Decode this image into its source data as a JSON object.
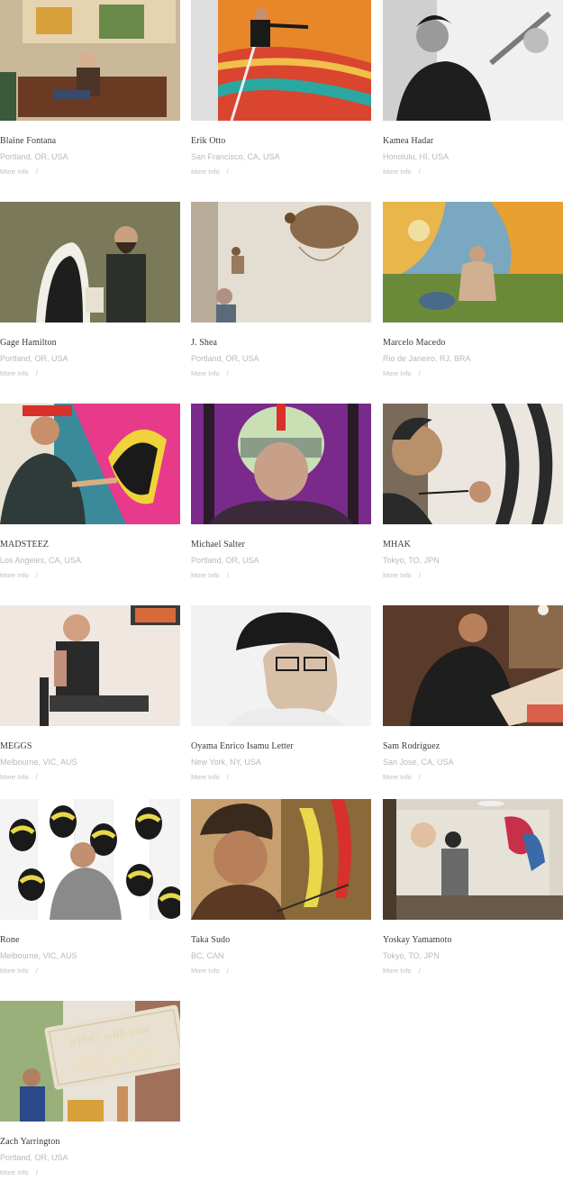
{
  "artists": [
    {
      "name": "Blaine Fontana",
      "location": "Portland, OR, USA",
      "more_info": "More Info",
      "separator": "/",
      "photo": "artist-with-mural-on-sofa",
      "colors": [
        "#c9b89a",
        "#4a3528",
        "#e6d3b0"
      ]
    },
    {
      "name": "Erik Otto",
      "location": "San Francisco, CA, USA",
      "more_info": "More Info",
      "separator": "/",
      "photo": "painter-on-ladder-orange-mural",
      "colors": [
        "#e8862a",
        "#d9452f",
        "#2aa8a0"
      ]
    },
    {
      "name": "Kamea Hadar",
      "location": "Honolulu, HI, USA",
      "more_info": "More Info",
      "separator": "/",
      "photo": "painter-black-and-white",
      "colors": [
        "#e5e5e5",
        "#6a6a6a",
        "#1e1e1e"
      ]
    },
    {
      "name": "Gage Hamilton",
      "location": "Portland, OR, USA",
      "more_info": "More Info",
      "separator": "/",
      "photo": "bearded-man-with-mural",
      "colors": [
        "#8a8a6a",
        "#2c2f2a",
        "#d6d2c4"
      ]
    },
    {
      "name": "J. Shea",
      "location": "Portland, OR, USA",
      "more_info": "More Info",
      "separator": "/",
      "photo": "gallery-sculpture-hanging",
      "colors": [
        "#e4ddd2",
        "#8a6a4a",
        "#b3a48f"
      ]
    },
    {
      "name": "Marcelo Macedo",
      "location": "Rio de Janeiro, RJ, BRA",
      "more_info": "More Info",
      "separator": "/",
      "photo": "painter-sitting-yellow-mural",
      "colors": [
        "#e8b64a",
        "#7aa8c0",
        "#6a8a3a"
      ]
    },
    {
      "name": "MADSTEEZ",
      "location": "Los Angeles, CA, USA",
      "more_info": "More Info",
      "separator": "/",
      "photo": "painter-red-beanie-colorful",
      "colors": [
        "#2f3a3a",
        "#e83a8a",
        "#f0d23a"
      ]
    },
    {
      "name": "Michael Salter",
      "location": "Portland, OR, USA",
      "more_info": "More Info",
      "separator": "/",
      "photo": "man-with-green-helmet-purple",
      "colors": [
        "#7a2a8a",
        "#c8e0b4",
        "#3a2a3a"
      ]
    },
    {
      "name": "MHAK",
      "location": "Tokyo, TO, JPN",
      "more_info": "More Info",
      "separator": "/",
      "photo": "painter-close-up-wall",
      "colors": [
        "#ece6e0",
        "#4a3a30",
        "#2a2a2a"
      ]
    },
    {
      "name": "MEGGS",
      "location": "Melbourne, VIC, AUS",
      "more_info": "More Info",
      "separator": "/",
      "photo": "tattooed-man-seated",
      "colors": [
        "#efe7e0",
        "#2a2a2a",
        "#c0907a"
      ]
    },
    {
      "name": "Oyama Enrico Isamu Letter",
      "location": "New York, NY, USA",
      "more_info": "More Info",
      "separator": "/",
      "photo": "man-glasses-profile",
      "colors": [
        "#f2f2f2",
        "#1a1a1a",
        "#d8c0a8"
      ]
    },
    {
      "name": "Sam Rodriguez",
      "location": "San Jose, CA, USA",
      "more_info": "More Info",
      "separator": "/",
      "photo": "artist-drawing-at-desk",
      "colors": [
        "#6a4a3a",
        "#1e1e1e",
        "#e8d8c4"
      ]
    },
    {
      "name": "Rone",
      "location": "Melbourne, VIC, AUS",
      "more_info": "More Info",
      "separator": "/",
      "photo": "painter-pop-art-faces",
      "colors": [
        "#e8d84a",
        "#1a1a1a",
        "#f0f0f0"
      ]
    },
    {
      "name": "Taka Sudo",
      "location": "BC, CAN",
      "more_info": "More Info",
      "separator": "/",
      "photo": "man-black-beanie-painting",
      "colors": [
        "#3a2a1e",
        "#c9a06a",
        "#e8d84a"
      ]
    },
    {
      "name": "Yoskay Yamamoto",
      "location": "Tokyo, TO, JPN",
      "more_info": "More Info",
      "separator": "/",
      "photo": "painter-at-canvas-studio",
      "colors": [
        "#e6e2d8",
        "#3a4a5a",
        "#c8304a"
      ]
    },
    {
      "name": "Zach Yarrington",
      "location": "Portland, OR, USA",
      "more_info": "More Info",
      "separator": "/",
      "photo": "sign-sing-with-you-heroes",
      "colors": [
        "#3a2a1e",
        "#e8e0d0",
        "#5a8a3a"
      ],
      "sign_text": [
        "SING with you",
        "HEROES"
      ]
    }
  ]
}
